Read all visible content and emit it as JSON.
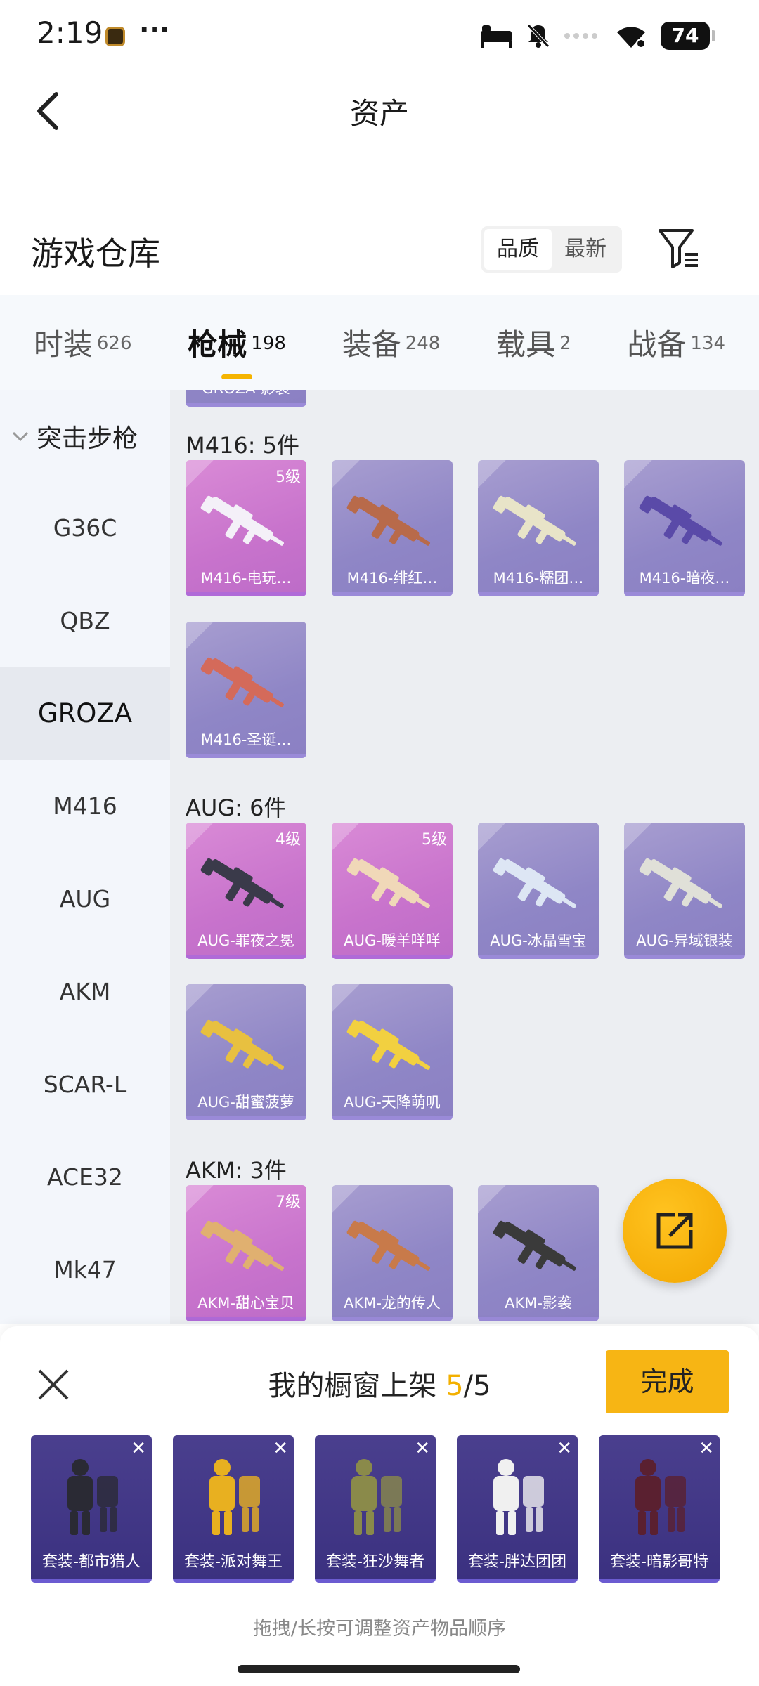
{
  "status": {
    "time": "2:19",
    "dots": "···",
    "battery": "74"
  },
  "header": {
    "title": "资产"
  },
  "warehouse": {
    "title": "游戏仓库",
    "sort": [
      "品质",
      "最新"
    ],
    "active_sort": "品质"
  },
  "tabs": [
    {
      "label": "时装",
      "count": "626"
    },
    {
      "label": "枪械",
      "count": "198",
      "active": true
    },
    {
      "label": "装备",
      "count": "248"
    },
    {
      "label": "载具",
      "count": "2"
    },
    {
      "label": "战备",
      "count": "134"
    }
  ],
  "sidebar": {
    "category": "突击步枪",
    "items": [
      "G36C",
      "QBZ",
      "GROZA",
      "M416",
      "AUG",
      "AKM",
      "SCAR-L",
      "ACE32",
      "Mk47"
    ],
    "active": "GROZA"
  },
  "prev_card_label": "GROZA-影袭",
  "sections": [
    {
      "title": "M416: 5件",
      "items": [
        {
          "label": "M416-电玩…",
          "badge": "5级",
          "rarity": "pink",
          "gun_color": "#f4f0f8"
        },
        {
          "label": "M416-绯红…",
          "badge": "",
          "rarity": "purple",
          "gun_color": "#b86a4a"
        },
        {
          "label": "M416-糯团…",
          "badge": "",
          "rarity": "purple",
          "gun_color": "#e8e4c8"
        },
        {
          "label": "M416-暗夜…",
          "badge": "",
          "rarity": "purple",
          "gun_color": "#5a4aa8"
        },
        {
          "label": "M416-圣诞…",
          "badge": "",
          "rarity": "purple",
          "gun_color": "#d46a5a"
        }
      ]
    },
    {
      "title": "AUG: 6件",
      "items": [
        {
          "label": "AUG-罪夜之冕",
          "badge": "4级",
          "rarity": "pink",
          "gun_color": "#3a3a4a"
        },
        {
          "label": "AUG-暖羊咩咩",
          "badge": "5级",
          "rarity": "pink",
          "gun_color": "#f0d8b8"
        },
        {
          "label": "AUG-冰晶雪宝",
          "badge": "",
          "rarity": "purple",
          "gun_color": "#dde6f4"
        },
        {
          "label": "AUG-异域银装",
          "badge": "",
          "rarity": "purple",
          "gun_color": "#e0e0d8"
        },
        {
          "label": "AUG-甜蜜菠萝",
          "badge": "",
          "rarity": "purple",
          "gun_color": "#e8c040"
        },
        {
          "label": "AUG-天降萌叽",
          "badge": "",
          "rarity": "purple",
          "gun_color": "#f2d040"
        }
      ]
    },
    {
      "title": "AKM: 3件",
      "items": [
        {
          "label": "AKM-甜心宝贝",
          "badge": "7级",
          "rarity": "pink",
          "gun_color": "#e0b070"
        },
        {
          "label": "AKM-龙的传人",
          "badge": "",
          "rarity": "purple",
          "gun_color": "#c87a4a"
        },
        {
          "label": "AKM-影袭",
          "badge": "",
          "rarity": "purple",
          "gun_color": "#3a3a3a"
        }
      ]
    }
  ],
  "sheet": {
    "title_prefix": "我的橱窗上架 ",
    "count": "5",
    "total": "/5",
    "done_label": "完成",
    "slots": [
      {
        "label": "套装-都市猎人",
        "figure_color": "#2a2a34"
      },
      {
        "label": "套装-派对舞王",
        "figure_color": "#e8b020"
      },
      {
        "label": "套装-狂沙舞者",
        "figure_color": "#8a8a4a"
      },
      {
        "label": "套装-胖达团团",
        "figure_color": "#f0f0f0"
      },
      {
        "label": "套装-暗影哥特",
        "figure_color": "#5a2030"
      }
    ],
    "remove_glyph": "✕",
    "hint": "拖拽/长按可调整资产物品顺序"
  },
  "colors": {
    "accent": "#f5b400",
    "done": "#f7b514",
    "pink_card": "#c873cc",
    "purple_card": "#8f86c6",
    "slot_bg": "#3b3180"
  }
}
